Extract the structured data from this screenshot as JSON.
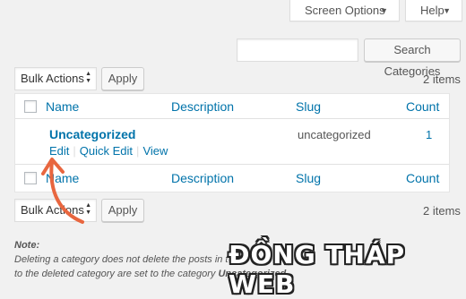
{
  "header": {
    "screen_options": "Screen Options",
    "help": "Help"
  },
  "search": {
    "value": "",
    "button": "Search Categories"
  },
  "top_nav": {
    "bulk_actions": "Bulk Actions",
    "apply": "Apply",
    "items_count": "2 items"
  },
  "bottom_nav": {
    "bulk_actions": "Bulk Actions",
    "apply": "Apply",
    "items_count": "2 items"
  },
  "table": {
    "columns": [
      "Name",
      "Description",
      "Slug",
      "Count"
    ],
    "footer_columns": [
      "Name",
      "Description",
      "Slug",
      "Count"
    ],
    "rows": [
      {
        "name": "Uncategorized",
        "description": "",
        "slug": "uncategorized",
        "count": "1",
        "actions": [
          "Edit",
          "Quick Edit",
          "View"
        ]
      }
    ]
  },
  "note": {
    "title": "Note:",
    "line1": "Deleting a category does not delete the posts in t",
    "line2_prefix": "to the deleted category are set to the category ",
    "line2_bold": "Uncategorized",
    "line2_suffix": "."
  },
  "watermark": "ĐỒNG THÁP WEB",
  "colors": {
    "link": "#0073aa",
    "annotation_arrow": "#e8663f",
    "background": "#f1f1f1"
  },
  "icons": {
    "dropdown": "caret-down-icon",
    "select_arrows": "up-down-arrows-icon",
    "annotation": "curved-arrow-icon"
  }
}
